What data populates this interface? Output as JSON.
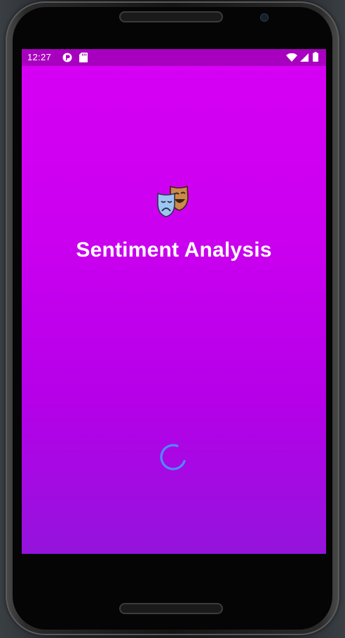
{
  "status_bar": {
    "time": "12:27",
    "left_icons": [
      "app-notification-icon",
      "sd-card-icon"
    ],
    "right_icons": [
      "wifi-icon",
      "cellular-signal-icon",
      "battery-icon"
    ]
  },
  "app": {
    "logo_icon": "theater-masks-icon",
    "title": "Sentiment Analysis",
    "loading_indicator": "loading-spinner"
  },
  "colors": {
    "background_top": "#d600f5",
    "background_bottom": "#9414dc",
    "status_bar": "#a800bf",
    "spinner": "#4a8cff",
    "title_text": "#ffffff"
  }
}
